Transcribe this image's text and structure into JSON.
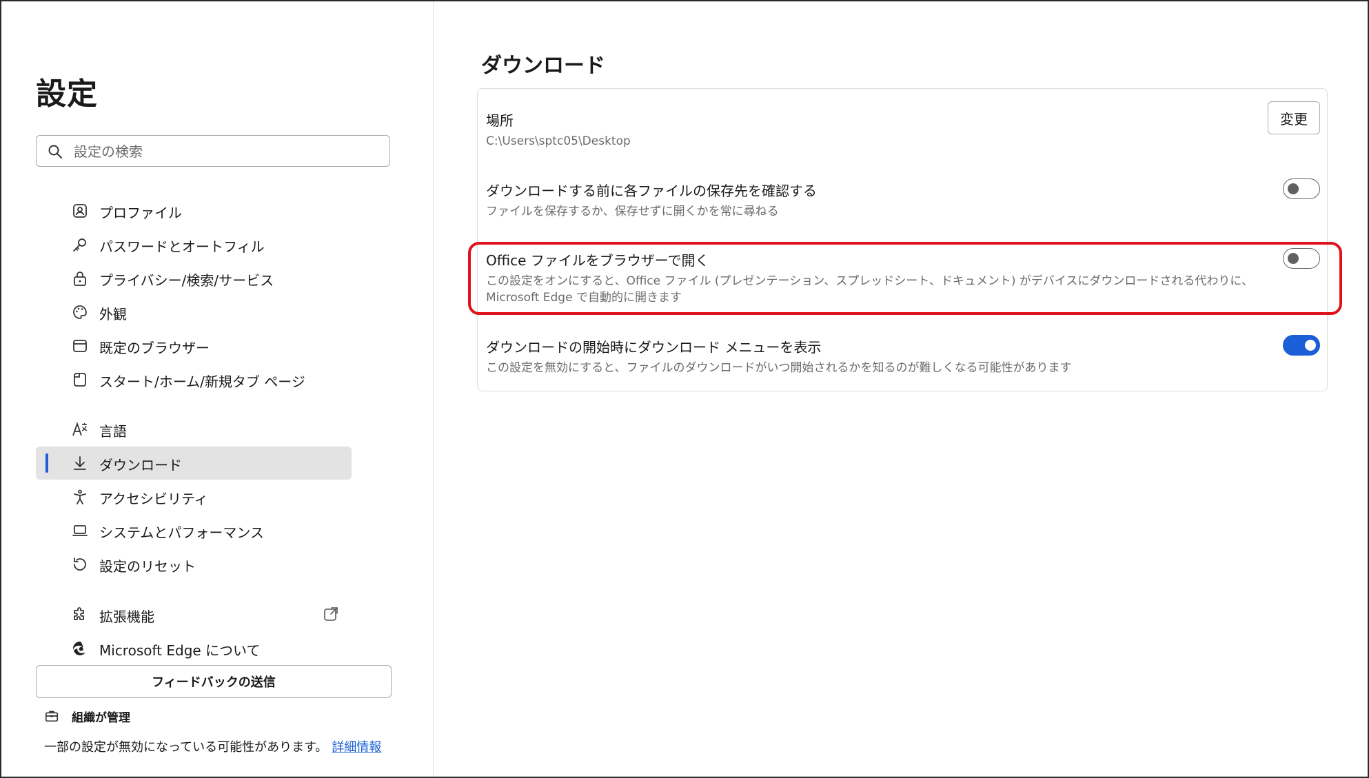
{
  "sidebar": {
    "title": "設定",
    "search": {
      "placeholder": "設定の検索",
      "value": ""
    },
    "items": [
      {
        "label": "プロファイル",
        "icon": "profile-icon"
      },
      {
        "label": "パスワードとオートフィル",
        "icon": "key-icon"
      },
      {
        "label": "プライバシー/検索/サービス",
        "icon": "lock-icon"
      },
      {
        "label": "外観",
        "icon": "palette-icon"
      },
      {
        "label": "既定のブラウザー",
        "icon": "browser-icon"
      },
      {
        "label": "スタート/ホーム/新規タブ ページ",
        "icon": "new-tab-icon"
      },
      {
        "label": "言語",
        "icon": "language-icon"
      },
      {
        "label": "ダウンロード",
        "icon": "download-icon",
        "active": true
      },
      {
        "label": "アクセシビリティ",
        "icon": "accessibility-icon"
      },
      {
        "label": "システムとパフォーマンス",
        "icon": "laptop-icon"
      },
      {
        "label": "設定のリセット",
        "icon": "reset-icon"
      },
      {
        "label": "拡張機能",
        "icon": "puzzle-icon"
      },
      {
        "label": "Microsoft Edge について",
        "icon": "edge-logo-icon"
      }
    ],
    "feedback_label": "フィードバックの送信",
    "org_label": "組織が管理",
    "org_note": "一部の設定が無効になっている可能性があります。",
    "org_link": "詳細情報"
  },
  "main": {
    "title": "ダウンロード",
    "location": {
      "title": "場所",
      "path": "C:\\Users\\sptc05\\Desktop",
      "button": "変更"
    },
    "settings": [
      {
        "title": "ダウンロードする前に各ファイルの保存先を確認する",
        "desc": "ファイルを保存するか、保存せずに開くかを常に尋ねる",
        "enabled": false
      },
      {
        "title": "Office ファイルをブラウザーで開く",
        "desc": "この設定をオンにすると、Office ファイル (プレゼンテーション、スプレッドシート、ドキュメント) がデバイスにダウンロードされる代わりに、Microsoft Edge で自動的に開きます",
        "enabled": false,
        "highlighted": true
      },
      {
        "title": "ダウンロードの開始時にダウンロード メニューを表示",
        "desc": "この設定を無効にすると、ファイルのダウンロードがいつ開始されるかを知るのが難しくなる可能性があります",
        "enabled": true
      }
    ]
  },
  "colors": {
    "accent": "#1a5fd6",
    "highlight": "#e0131c",
    "active_bg": "#e3e3e3"
  }
}
